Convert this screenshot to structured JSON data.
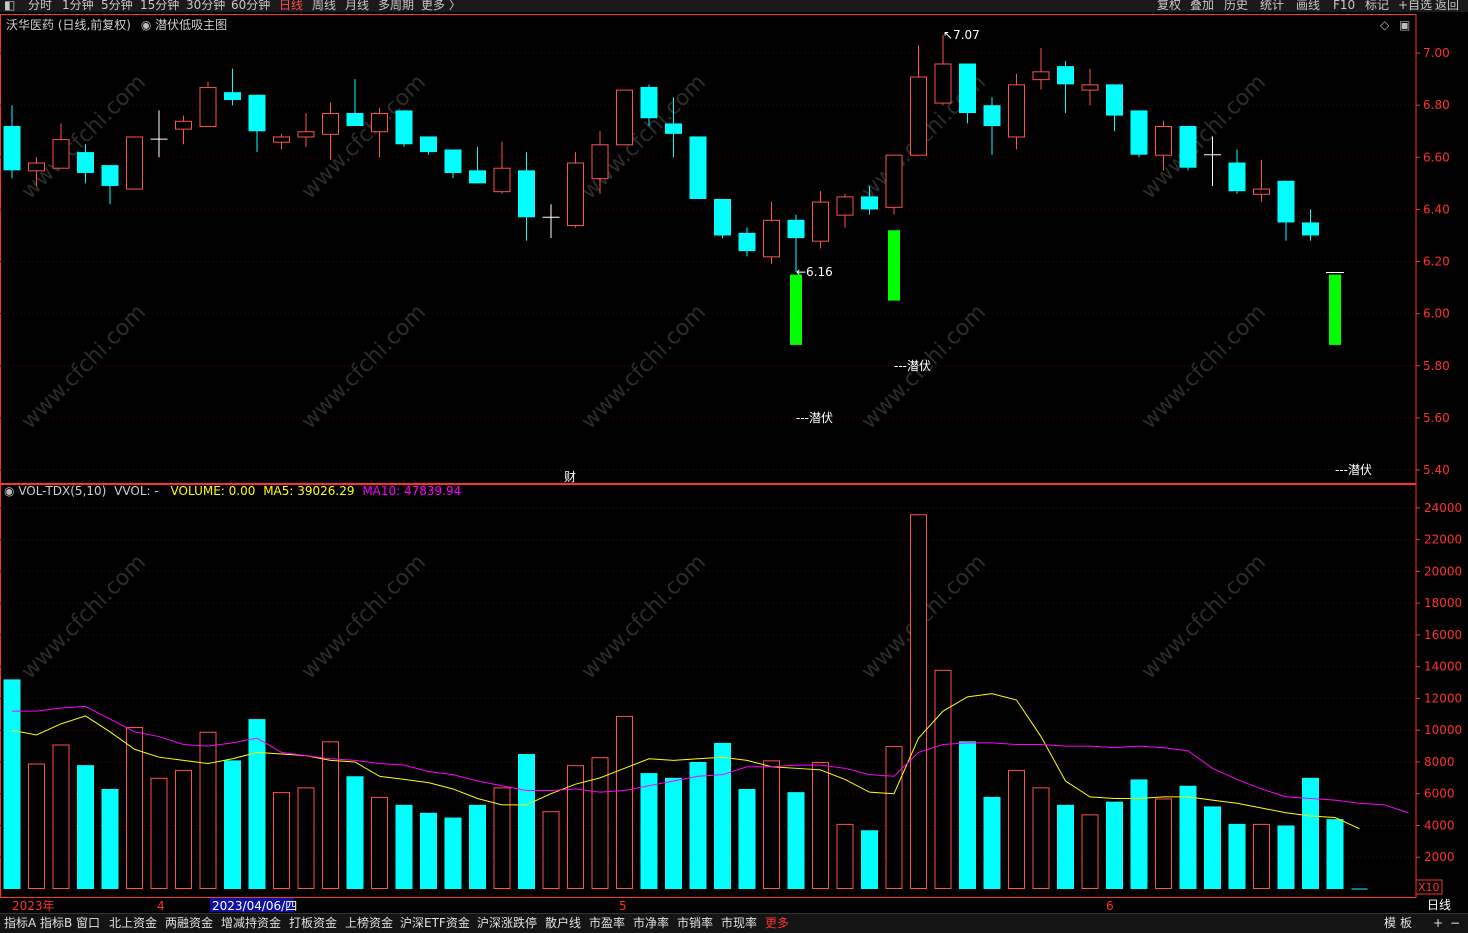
{
  "toolbar": {
    "left_items": [
      "分时",
      "1分钟",
      "5分钟",
      "15分钟",
      "30分钟",
      "60分钟",
      "日线",
      "周线",
      "月线",
      "多周期",
      "更多 〉"
    ],
    "active_item": "日线",
    "right_items": [
      "复权",
      "叠加",
      "历史",
      "统计",
      "画线",
      "F10",
      "标记",
      "+自选",
      "返回"
    ]
  },
  "main_title": {
    "stock": "沃华医药 (日线,前复权)",
    "formula": "潜伏低吸主图"
  },
  "indicator_title": {
    "name": "VOL-TDX(5,10)",
    "vvol": "VVOL: -",
    "volume": "VOLUME: 0.00",
    "ma5": "MA5: 39026.29",
    "ma10": "MA10: 47839.94"
  },
  "bottom_tabs": [
    "指标A",
    "指标B",
    "窗口",
    "北上资金",
    "两融资金",
    "增减持资金",
    "打板资金",
    "上榜资金",
    "沪深ETF资金",
    "沪深涨跌停",
    "散户线",
    "市盈率",
    "市净率",
    "市销率",
    "市现率",
    "更多"
  ],
  "bottom_right": [
    "模",
    "板",
    "+",
    "−"
  ],
  "period_label": "日线",
  "x10_label": "X10",
  "cai_label": "财",
  "watermark": "www.cfchi.com",
  "colors": {
    "up": "#ff5050",
    "down": "#00ffff",
    "signal": "#00ff00",
    "ma5": "#ffff00",
    "ma10": "#ff00ff",
    "axis": "#ff3030",
    "grid": "#5a0000"
  },
  "chart_data": [
    {
      "type": "candlestick",
      "title": "沃华医药 (日线,前复权)",
      "ylim": [
        5.35,
        7.15
      ],
      "yticks": [
        7.0,
        6.8,
        6.6,
        6.4,
        6.2,
        6.0,
        5.8,
        5.6,
        5.4
      ],
      "xaxis": [
        "2023年",
        "4",
        "2023/04/06/四",
        "5",
        "6"
      ],
      "bars": [
        {
          "o": 6.72,
          "h": 6.8,
          "l": 6.52,
          "c": 6.55
        },
        {
          "o": 6.55,
          "h": 6.6,
          "l": 6.49,
          "c": 6.58
        },
        {
          "o": 6.56,
          "h": 6.73,
          "l": 6.56,
          "c": 6.67
        },
        {
          "o": 6.62,
          "h": 6.65,
          "l": 6.5,
          "c": 6.54
        },
        {
          "o": 6.57,
          "h": 6.57,
          "l": 6.42,
          "c": 6.49
        },
        {
          "o": 6.48,
          "h": 6.68,
          "l": 6.48,
          "c": 6.68
        },
        {
          "o": 6.67,
          "h": 6.78,
          "l": 6.6,
          "c": 6.67
        },
        {
          "o": 6.71,
          "h": 6.76,
          "l": 6.65,
          "c": 6.74
        },
        {
          "o": 6.72,
          "h": 6.89,
          "l": 6.72,
          "c": 6.87
        },
        {
          "o": 6.85,
          "h": 6.94,
          "l": 6.8,
          "c": 6.82
        },
        {
          "o": 6.84,
          "h": 6.84,
          "l": 6.62,
          "c": 6.7
        },
        {
          "o": 6.66,
          "h": 6.69,
          "l": 6.63,
          "c": 6.68
        },
        {
          "o": 6.68,
          "h": 6.77,
          "l": 6.64,
          "c": 6.7
        },
        {
          "o": 6.69,
          "h": 6.81,
          "l": 6.59,
          "c": 6.77
        },
        {
          "o": 6.77,
          "h": 6.9,
          "l": 6.73,
          "c": 6.72
        },
        {
          "o": 6.7,
          "h": 6.79,
          "l": 6.6,
          "c": 6.77
        },
        {
          "o": 6.78,
          "h": 6.78,
          "l": 6.64,
          "c": 6.65
        },
        {
          "o": 6.68,
          "h": 6.68,
          "l": 6.61,
          "c": 6.62
        },
        {
          "o": 6.63,
          "h": 6.63,
          "l": 6.52,
          "c": 6.54
        },
        {
          "o": 6.55,
          "h": 6.64,
          "l": 6.5,
          "c": 6.5
        },
        {
          "o": 6.47,
          "h": 6.66,
          "l": 6.46,
          "c": 6.56
        },
        {
          "o": 6.55,
          "h": 6.62,
          "l": 6.28,
          "c": 6.37
        },
        {
          "o": 6.36,
          "h": 6.42,
          "l": 6.29,
          "c": 6.37
        },
        {
          "o": 6.34,
          "h": 6.62,
          "l": 6.33,
          "c": 6.58
        },
        {
          "o": 6.52,
          "h": 6.7,
          "l": 6.46,
          "c": 6.65
        },
        {
          "o": 6.65,
          "h": 6.76,
          "l": 6.67,
          "c": 6.86
        },
        {
          "o": 6.87,
          "h": 6.88,
          "l": 6.72,
          "c": 6.75
        },
        {
          "o": 6.73,
          "h": 6.83,
          "l": 6.6,
          "c": 6.69
        },
        {
          "o": 6.68,
          "h": 6.68,
          "l": 6.44,
          "c": 6.44
        },
        {
          "o": 6.44,
          "h": 6.44,
          "l": 6.29,
          "c": 6.3
        },
        {
          "o": 6.31,
          "h": 6.33,
          "l": 6.22,
          "c": 6.24
        },
        {
          "o": 6.22,
          "h": 6.43,
          "l": 6.19,
          "c": 6.36
        },
        {
          "o": 6.36,
          "h": 6.38,
          "l": 6.16,
          "c": 6.29
        },
        {
          "o": 6.28,
          "h": 6.47,
          "l": 6.25,
          "c": 6.43
        },
        {
          "o": 6.38,
          "h": 6.46,
          "l": 6.33,
          "c": 6.45
        },
        {
          "o": 6.45,
          "h": 6.49,
          "l": 6.38,
          "c": 6.4
        },
        {
          "o": 6.41,
          "h": 6.61,
          "l": 6.38,
          "c": 6.61
        },
        {
          "o": 6.61,
          "h": 7.03,
          "l": 6.61,
          "c": 6.91
        },
        {
          "o": 6.81,
          "h": 7.07,
          "l": 6.8,
          "c": 6.96
        },
        {
          "o": 6.96,
          "h": 6.96,
          "l": 6.73,
          "c": 6.77
        },
        {
          "o": 6.8,
          "h": 6.83,
          "l": 6.61,
          "c": 6.72
        },
        {
          "o": 6.68,
          "h": 6.92,
          "l": 6.63,
          "c": 6.88
        },
        {
          "o": 6.9,
          "h": 7.02,
          "l": 6.86,
          "c": 6.93
        },
        {
          "o": 6.95,
          "h": 6.97,
          "l": 6.77,
          "c": 6.88
        },
        {
          "o": 6.86,
          "h": 6.94,
          "l": 6.8,
          "c": 6.88
        },
        {
          "o": 6.88,
          "h": 6.88,
          "l": 6.7,
          "c": 6.76
        },
        {
          "o": 6.78,
          "h": 6.78,
          "l": 6.6,
          "c": 6.61
        },
        {
          "o": 6.61,
          "h": 6.74,
          "l": 6.55,
          "c": 6.72
        },
        {
          "o": 6.72,
          "h": 6.72,
          "l": 6.55,
          "c": 6.56
        },
        {
          "o": 6.61,
          "h": 6.68,
          "l": 6.49,
          "c": 6.6
        },
        {
          "o": 6.58,
          "h": 6.63,
          "l": 6.46,
          "c": 6.47
        },
        {
          "o": 6.46,
          "h": 6.59,
          "l": 6.43,
          "c": 6.48
        },
        {
          "o": 6.51,
          "h": 6.51,
          "l": 6.28,
          "c": 6.35
        },
        {
          "o": 6.35,
          "h": 6.4,
          "l": 6.28,
          "c": 6.3
        }
      ],
      "signals": [
        {
          "index": 32,
          "top": 6.15,
          "bottom": 5.88
        },
        {
          "index": 36,
          "top": 6.32,
          "bottom": 6.05
        },
        {
          "index": 54,
          "top": 6.15,
          "bottom": 5.88
        }
      ],
      "annotations": [
        {
          "text": "7.07",
          "index": 38,
          "price": 7.07
        },
        {
          "text": "6.16",
          "index": 32,
          "price": 6.16
        },
        {
          "text": "---潜伏",
          "index": 32,
          "price": 5.6
        },
        {
          "text": "---潜伏",
          "index": 36,
          "price": 5.8
        },
        {
          "text": "---潜伏",
          "index": 54,
          "price": 5.4
        }
      ]
    },
    {
      "type": "bar",
      "title": "VOL-TDX(5,10)",
      "ylim": [
        0,
        25000
      ],
      "yticks": [
        24000,
        22000,
        20000,
        18000,
        16000,
        14000,
        12000,
        10000,
        8000,
        6000,
        4000,
        2000
      ],
      "unit_label": "X10",
      "values": [
        13200,
        7900,
        9100,
        7800,
        6300,
        10200,
        7000,
        7500,
        9900,
        8100,
        10700,
        6100,
        6400,
        9300,
        7100,
        5800,
        5300,
        4800,
        4500,
        5300,
        6400,
        8500,
        4900,
        7800,
        8300,
        10900,
        7300,
        7000,
        8000,
        9200,
        6300,
        8100,
        6100,
        8000,
        4100,
        3700,
        9000,
        23600,
        13800,
        9300,
        5800,
        7500,
        6400,
        5300,
        4700,
        5500,
        6900,
        5700,
        6500,
        5200,
        4100,
        4100,
        4000,
        7000,
        4400,
        0
      ],
      "series": [
        {
          "name": "MA5",
          "values": [
            10000,
            9700,
            10400,
            10900,
            9900,
            8800,
            8300,
            8100,
            7900,
            8200,
            8600,
            8500,
            8400,
            8100,
            8000,
            7100,
            6900,
            6700,
            6300,
            5700,
            5300,
            5300,
            6000,
            6600,
            7000,
            7600,
            8200,
            8100,
            8200,
            8300,
            8100,
            7700,
            7600,
            7500,
            6900,
            6100,
            6000,
            9500,
            11200,
            12100,
            12300,
            11900,
            9600,
            6800,
            5800,
            5700,
            5700,
            5800,
            5800,
            5600,
            5400,
            5100,
            4800,
            4600,
            4500,
            3800
          ]
        },
        {
          "name": "MA10",
          "values": [
            11200,
            11200,
            11400,
            11500,
            10700,
            9900,
            9600,
            9100,
            9000,
            9200,
            9500,
            8600,
            8400,
            8200,
            8100,
            7900,
            7800,
            7400,
            7200,
            6800,
            6500,
            6200,
            6200,
            6300,
            6100,
            6200,
            6500,
            6800,
            7100,
            7200,
            7700,
            7700,
            7800,
            7800,
            7600,
            7200,
            7100,
            8600,
            9100,
            9200,
            9200,
            9100,
            9100,
            9000,
            9000,
            8900,
            9000,
            8900,
            8700,
            7600,
            6900,
            6300,
            5800,
            5700,
            5600,
            5400,
            5300,
            4800
          ]
        }
      ]
    }
  ]
}
